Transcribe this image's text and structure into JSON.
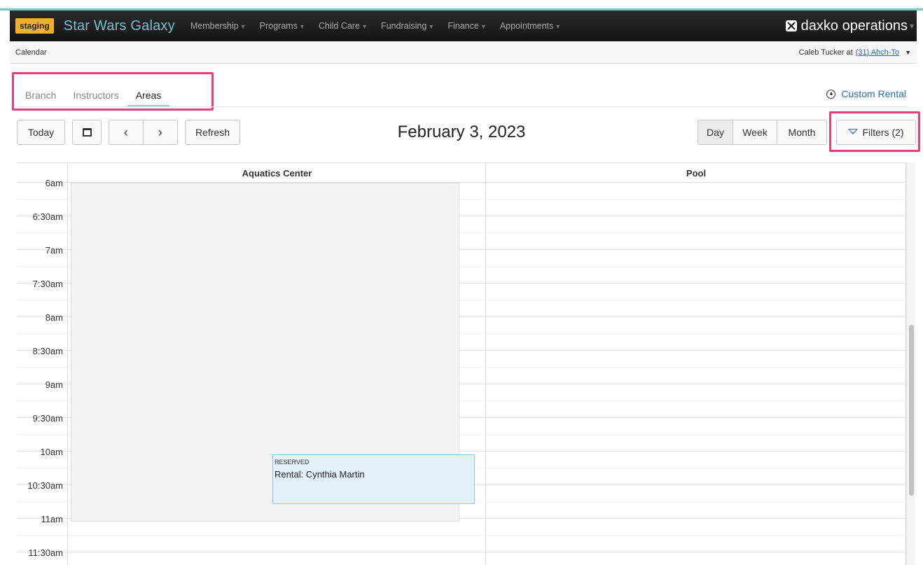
{
  "navbar": {
    "env_badge": "staging",
    "brand": "Star Wars Galaxy",
    "menu": [
      {
        "label": "Membership"
      },
      {
        "label": "Programs"
      },
      {
        "label": "Child Care"
      },
      {
        "label": "Fundraising"
      },
      {
        "label": "Finance"
      },
      {
        "label": "Appointments"
      }
    ],
    "product": "daxko operations"
  },
  "subbar": {
    "page": "Calendar",
    "user_prefix": "Caleb Tucker at",
    "location": "(31) Ahch-To"
  },
  "tabs": [
    {
      "label": "Branch",
      "active": false
    },
    {
      "label": "Instructors",
      "active": false
    },
    {
      "label": "Areas",
      "active": true
    }
  ],
  "custom_rental": "Custom Rental",
  "toolbar": {
    "today": "Today",
    "refresh": "Refresh",
    "prev_glyph": "‹",
    "next_glyph": "›",
    "date": "February 3, 2023",
    "views": [
      "Day",
      "Week",
      "Month"
    ],
    "active_view": "Day",
    "filters": "Filters (2)"
  },
  "calendar": {
    "columns": [
      "Aquatics Center",
      "Pool"
    ],
    "times": [
      "6am",
      "6:30am",
      "7am",
      "7:30am",
      "8am",
      "8:30am",
      "9am",
      "9:30am",
      "10am",
      "10:30am",
      "11am",
      "11:30am"
    ],
    "event": {
      "status": "RESERVED",
      "title": "Rental: Cynthia Martin"
    }
  },
  "colors": {
    "accent": "#7fc6c9",
    "badge": "#f3b12a",
    "highlight": "#e8407a",
    "link": "#2a6bb8",
    "event_bg": "#e3f1fc"
  }
}
